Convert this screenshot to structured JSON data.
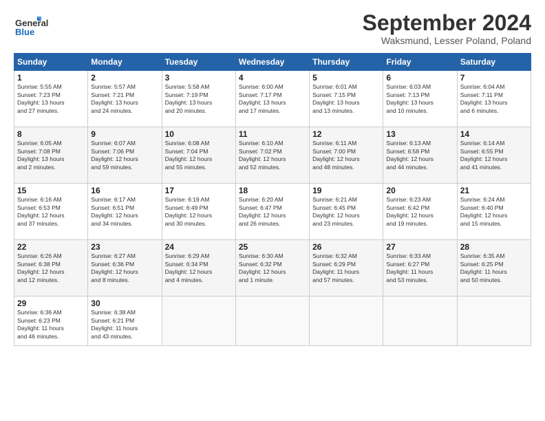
{
  "header": {
    "logo_general": "General",
    "logo_blue": "Blue",
    "title": "September 2024",
    "location": "Waksmund, Lesser Poland, Poland"
  },
  "weekdays": [
    "Sunday",
    "Monday",
    "Tuesday",
    "Wednesday",
    "Thursday",
    "Friday",
    "Saturday"
  ],
  "weeks": [
    [
      {
        "day": "1",
        "info": "Sunrise: 5:55 AM\nSunset: 7:23 PM\nDaylight: 13 hours\nand 27 minutes."
      },
      {
        "day": "2",
        "info": "Sunrise: 5:57 AM\nSunset: 7:21 PM\nDaylight: 13 hours\nand 24 minutes."
      },
      {
        "day": "3",
        "info": "Sunrise: 5:58 AM\nSunset: 7:19 PM\nDaylight: 13 hours\nand 20 minutes."
      },
      {
        "day": "4",
        "info": "Sunrise: 6:00 AM\nSunset: 7:17 PM\nDaylight: 13 hours\nand 17 minutes."
      },
      {
        "day": "5",
        "info": "Sunrise: 6:01 AM\nSunset: 7:15 PM\nDaylight: 13 hours\nand 13 minutes."
      },
      {
        "day": "6",
        "info": "Sunrise: 6:03 AM\nSunset: 7:13 PM\nDaylight: 13 hours\nand 10 minutes."
      },
      {
        "day": "7",
        "info": "Sunrise: 6:04 AM\nSunset: 7:11 PM\nDaylight: 13 hours\nand 6 minutes."
      }
    ],
    [
      {
        "day": "8",
        "info": "Sunrise: 6:05 AM\nSunset: 7:08 PM\nDaylight: 13 hours\nand 2 minutes."
      },
      {
        "day": "9",
        "info": "Sunrise: 6:07 AM\nSunset: 7:06 PM\nDaylight: 12 hours\nand 59 minutes."
      },
      {
        "day": "10",
        "info": "Sunrise: 6:08 AM\nSunset: 7:04 PM\nDaylight: 12 hours\nand 55 minutes."
      },
      {
        "day": "11",
        "info": "Sunrise: 6:10 AM\nSunset: 7:02 PM\nDaylight: 12 hours\nand 52 minutes."
      },
      {
        "day": "12",
        "info": "Sunrise: 6:11 AM\nSunset: 7:00 PM\nDaylight: 12 hours\nand 48 minutes."
      },
      {
        "day": "13",
        "info": "Sunrise: 6:13 AM\nSunset: 6:58 PM\nDaylight: 12 hours\nand 44 minutes."
      },
      {
        "day": "14",
        "info": "Sunrise: 6:14 AM\nSunset: 6:55 PM\nDaylight: 12 hours\nand 41 minutes."
      }
    ],
    [
      {
        "day": "15",
        "info": "Sunrise: 6:16 AM\nSunset: 6:53 PM\nDaylight: 12 hours\nand 37 minutes."
      },
      {
        "day": "16",
        "info": "Sunrise: 6:17 AM\nSunset: 6:51 PM\nDaylight: 12 hours\nand 34 minutes."
      },
      {
        "day": "17",
        "info": "Sunrise: 6:19 AM\nSunset: 6:49 PM\nDaylight: 12 hours\nand 30 minutes."
      },
      {
        "day": "18",
        "info": "Sunrise: 6:20 AM\nSunset: 6:47 PM\nDaylight: 12 hours\nand 26 minutes."
      },
      {
        "day": "19",
        "info": "Sunrise: 6:21 AM\nSunset: 6:45 PM\nDaylight: 12 hours\nand 23 minutes."
      },
      {
        "day": "20",
        "info": "Sunrise: 6:23 AM\nSunset: 6:42 PM\nDaylight: 12 hours\nand 19 minutes."
      },
      {
        "day": "21",
        "info": "Sunrise: 6:24 AM\nSunset: 6:40 PM\nDaylight: 12 hours\nand 15 minutes."
      }
    ],
    [
      {
        "day": "22",
        "info": "Sunrise: 6:26 AM\nSunset: 6:38 PM\nDaylight: 12 hours\nand 12 minutes."
      },
      {
        "day": "23",
        "info": "Sunrise: 6:27 AM\nSunset: 6:36 PM\nDaylight: 12 hours\nand 8 minutes."
      },
      {
        "day": "24",
        "info": "Sunrise: 6:29 AM\nSunset: 6:34 PM\nDaylight: 12 hours\nand 4 minutes."
      },
      {
        "day": "25",
        "info": "Sunrise: 6:30 AM\nSunset: 6:32 PM\nDaylight: 12 hours\nand 1 minute."
      },
      {
        "day": "26",
        "info": "Sunrise: 6:32 AM\nSunset: 6:29 PM\nDaylight: 11 hours\nand 57 minutes."
      },
      {
        "day": "27",
        "info": "Sunrise: 6:33 AM\nSunset: 6:27 PM\nDaylight: 11 hours\nand 53 minutes."
      },
      {
        "day": "28",
        "info": "Sunrise: 6:35 AM\nSunset: 6:25 PM\nDaylight: 11 hours\nand 50 minutes."
      }
    ],
    [
      {
        "day": "29",
        "info": "Sunrise: 6:36 AM\nSunset: 6:23 PM\nDaylight: 11 hours\nand 46 minutes."
      },
      {
        "day": "30",
        "info": "Sunrise: 6:38 AM\nSunset: 6:21 PM\nDaylight: 11 hours\nand 43 minutes."
      },
      {
        "day": "",
        "info": ""
      },
      {
        "day": "",
        "info": ""
      },
      {
        "day": "",
        "info": ""
      },
      {
        "day": "",
        "info": ""
      },
      {
        "day": "",
        "info": ""
      }
    ]
  ]
}
